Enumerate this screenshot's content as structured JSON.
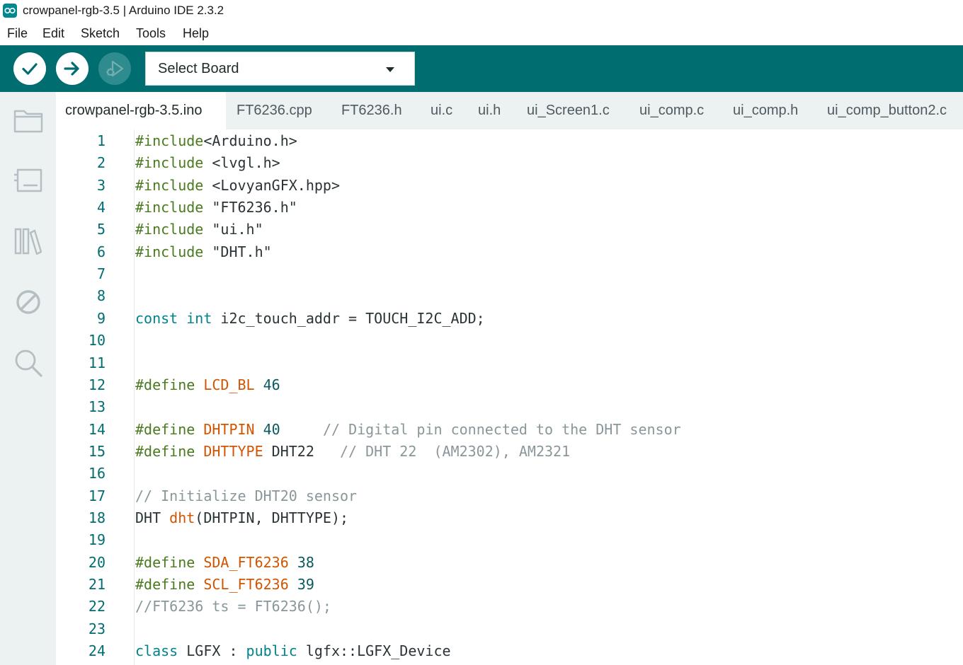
{
  "window": {
    "title": "crowpanel-rgb-3.5 | Arduino IDE 2.3.2"
  },
  "menu": {
    "items": [
      "File",
      "Edit",
      "Sketch",
      "Tools",
      "Help"
    ]
  },
  "toolbar": {
    "verify_icon": "check-icon",
    "upload_icon": "arrow-right-icon",
    "debug_icon": "debug-icon",
    "board_select_label": "Select Board",
    "accent_color": "#006d70"
  },
  "sidebar": {
    "icons": [
      "folder-icon",
      "board-manager-icon",
      "library-icon",
      "no-entry-icon",
      "search-icon"
    ]
  },
  "tabs": [
    {
      "label": "crowpanel-rgb-3.5.ino",
      "active": true
    },
    {
      "label": "FT6236.cpp",
      "active": false
    },
    {
      "label": "FT6236.h",
      "active": false
    },
    {
      "label": "ui.c",
      "active": false
    },
    {
      "label": "ui.h",
      "active": false
    },
    {
      "label": "ui_Screen1.c",
      "active": false
    },
    {
      "label": "ui_comp.c",
      "active": false
    },
    {
      "label": "ui_comp.h",
      "active": false
    },
    {
      "label": "ui_comp_button2.c",
      "active": false
    }
  ],
  "editor": {
    "lines": [
      {
        "n": "1",
        "tokens": [
          [
            "inc",
            "#include"
          ],
          [
            "txt",
            "<Arduino.h>"
          ]
        ]
      },
      {
        "n": "2",
        "tokens": [
          [
            "inc",
            "#include"
          ],
          [
            "txt",
            " <lvgl.h>"
          ]
        ]
      },
      {
        "n": "3",
        "tokens": [
          [
            "inc",
            "#include"
          ],
          [
            "txt",
            " <LovyanGFX.hpp>"
          ]
        ]
      },
      {
        "n": "4",
        "tokens": [
          [
            "inc",
            "#include"
          ],
          [
            "txt",
            " \"FT6236.h\""
          ]
        ]
      },
      {
        "n": "5",
        "tokens": [
          [
            "inc",
            "#include"
          ],
          [
            "txt",
            " \"ui.h\""
          ]
        ]
      },
      {
        "n": "6",
        "tokens": [
          [
            "inc",
            "#include"
          ],
          [
            "txt",
            " \"DHT.h\""
          ]
        ]
      },
      {
        "n": "7",
        "tokens": []
      },
      {
        "n": "8",
        "tokens": []
      },
      {
        "n": "9",
        "tokens": [
          [
            "kw",
            "const"
          ],
          [
            "txt",
            " "
          ],
          [
            "kw",
            "int"
          ],
          [
            "txt",
            " i2c_touch_addr = TOUCH_I2C_ADD;"
          ]
        ]
      },
      {
        "n": "10",
        "tokens": []
      },
      {
        "n": "11",
        "tokens": []
      },
      {
        "n": "12",
        "tokens": [
          [
            "inc",
            "#define"
          ],
          [
            "txt",
            " "
          ],
          [
            "def",
            "LCD_BL"
          ],
          [
            "txt",
            " "
          ],
          [
            "num",
            "46"
          ]
        ]
      },
      {
        "n": "13",
        "tokens": []
      },
      {
        "n": "14",
        "tokens": [
          [
            "inc",
            "#define"
          ],
          [
            "txt",
            " "
          ],
          [
            "def",
            "DHTPIN"
          ],
          [
            "txt",
            " "
          ],
          [
            "num",
            "40"
          ],
          [
            "txt",
            "     "
          ],
          [
            "com",
            "// Digital pin connected to the DHT sensor"
          ]
        ]
      },
      {
        "n": "15",
        "tokens": [
          [
            "inc",
            "#define"
          ],
          [
            "txt",
            " "
          ],
          [
            "def",
            "DHTTYPE"
          ],
          [
            "txt",
            " DHT22   "
          ],
          [
            "com",
            "// DHT 22  (AM2302), AM2321"
          ]
        ]
      },
      {
        "n": "16",
        "tokens": []
      },
      {
        "n": "17",
        "tokens": [
          [
            "com",
            "// Initialize DHT20 sensor"
          ]
        ]
      },
      {
        "n": "18",
        "tokens": [
          [
            "txt",
            "DHT "
          ],
          [
            "fn",
            "dht"
          ],
          [
            "txt",
            "(DHTPIN, DHTTYPE);"
          ]
        ]
      },
      {
        "n": "19",
        "tokens": []
      },
      {
        "n": "20",
        "tokens": [
          [
            "inc",
            "#define"
          ],
          [
            "txt",
            " "
          ],
          [
            "def",
            "SDA_FT6236"
          ],
          [
            "txt",
            " "
          ],
          [
            "num",
            "38"
          ]
        ]
      },
      {
        "n": "21",
        "tokens": [
          [
            "inc",
            "#define"
          ],
          [
            "txt",
            " "
          ],
          [
            "def",
            "SCL_FT6236"
          ],
          [
            "txt",
            " "
          ],
          [
            "num",
            "39"
          ]
        ]
      },
      {
        "n": "22",
        "tokens": [
          [
            "com",
            "//FT6236 ts = FT6236();"
          ]
        ]
      },
      {
        "n": "23",
        "tokens": []
      },
      {
        "n": "24",
        "tokens": [
          [
            "kw",
            "class"
          ],
          [
            "txt",
            " LGFX : "
          ],
          [
            "kw",
            "public"
          ],
          [
            "txt",
            " lgfx::LGFX_Device"
          ]
        ]
      }
    ]
  }
}
